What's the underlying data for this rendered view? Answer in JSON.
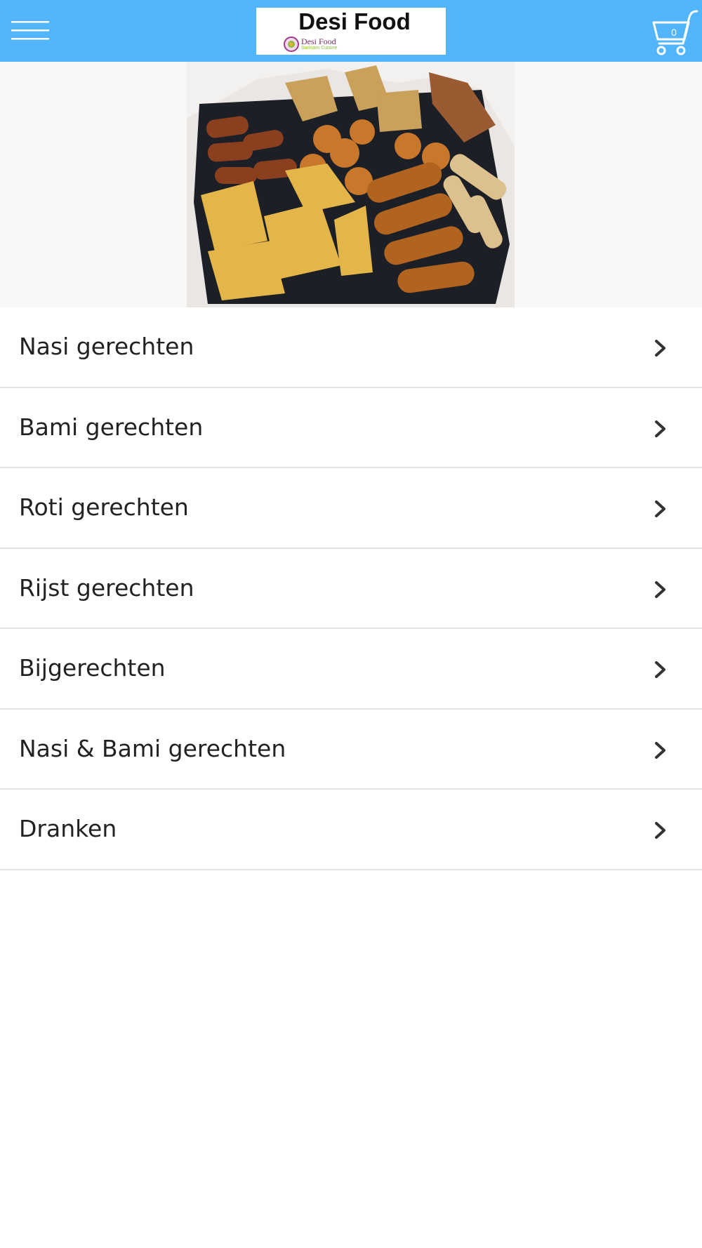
{
  "header": {
    "menu_icon": "hamburger-menu-icon",
    "logo": {
      "title": "Desi Food",
      "badge_text": "Desi Food",
      "badge_subtext": "Surinam Cuisine"
    },
    "cart": {
      "icon": "shopping-cart-icon",
      "count": "0"
    },
    "colors": {
      "bar": "#52b5fb",
      "icon": "#ffffff"
    }
  },
  "hero": {
    "image": "snack-platter-photo"
  },
  "categories": [
    {
      "label": "Nasi gerechten"
    },
    {
      "label": "Bami gerechten"
    },
    {
      "label": "Roti gerechten"
    },
    {
      "label": "Rijst gerechten"
    },
    {
      "label": "Bijgerechten"
    },
    {
      "label": "Nasi & Bami gerechten"
    },
    {
      "label": "Dranken"
    }
  ],
  "chevron_icon": "chevron-right-icon"
}
